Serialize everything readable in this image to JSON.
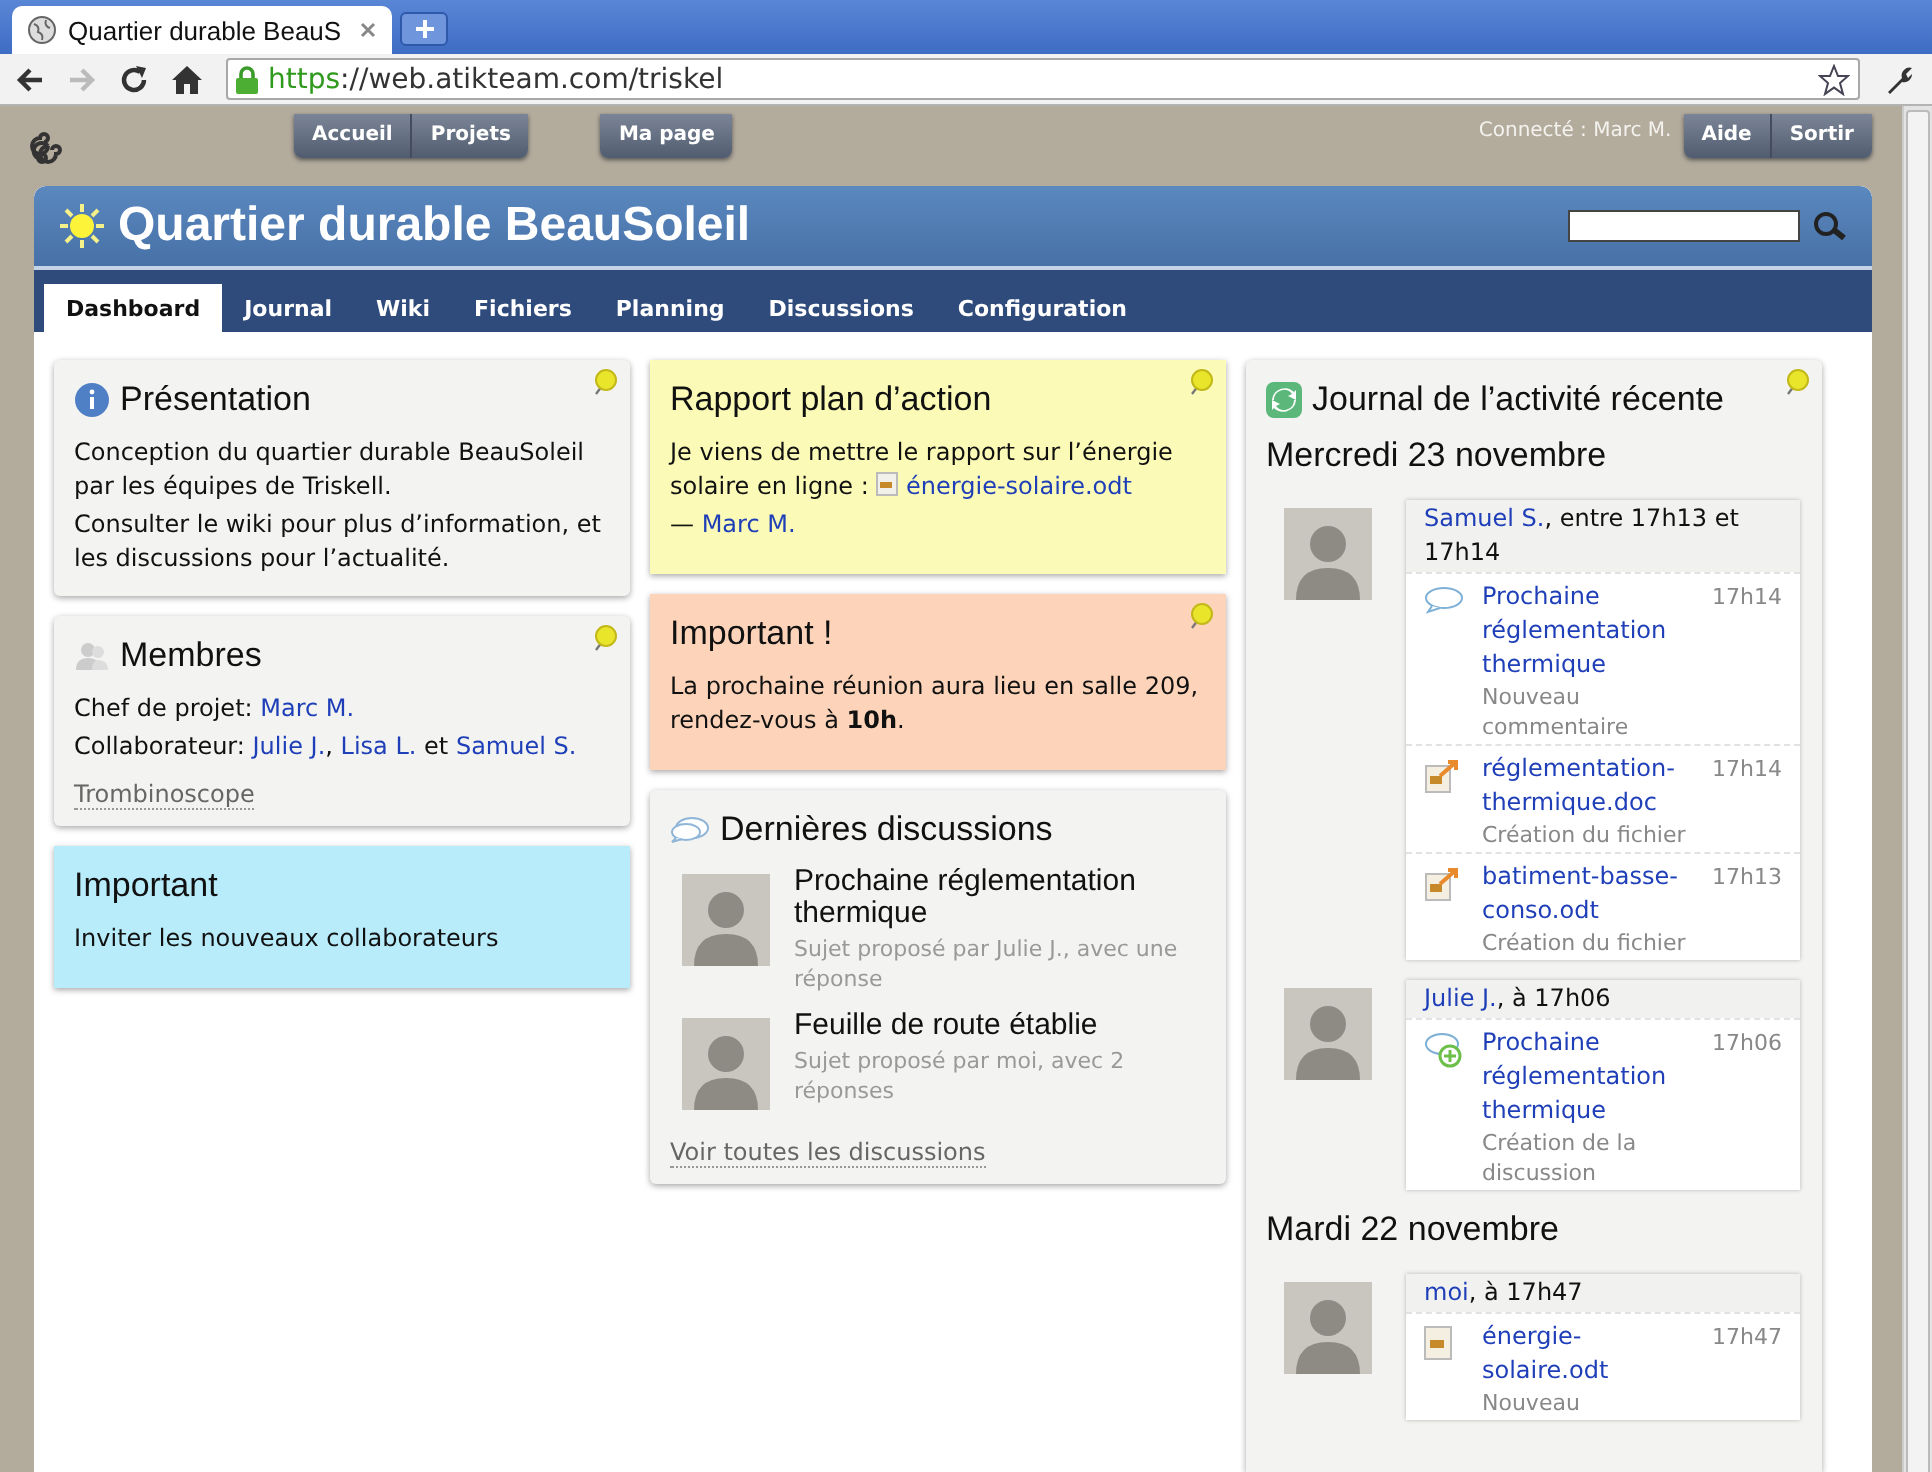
{
  "browser": {
    "tab_title": "Quartier durable BeauS",
    "url_scheme": "https",
    "url_rest": "://web.atikteam.com/triskel"
  },
  "top_nav": {
    "left_buttons": [
      "Accueil",
      "Projets"
    ],
    "my_page": "Ma page",
    "connected": "Connecté : Marc M.",
    "right_buttons": [
      "Aide",
      "Sortir"
    ]
  },
  "title": "Quartier durable BeauSoleil",
  "tabs": [
    {
      "label": "Dashboard",
      "selected": true
    },
    {
      "label": "Journal",
      "selected": false
    },
    {
      "label": "Wiki",
      "selected": false
    },
    {
      "label": "Fichiers",
      "selected": false
    },
    {
      "label": "Planning",
      "selected": false
    },
    {
      "label": "Discussions",
      "selected": false
    },
    {
      "label": "Configuration",
      "selected": false
    }
  ],
  "columns": [
    [
      {
        "kind": "presentation",
        "title": "Présentation",
        "color": "#f3f4f1",
        "pinned": true,
        "lines": [
          [
            {
              "kind": "text",
              "text": "Conception du quartier durable BeauSoleil par les équipes de Triskell."
            }
          ],
          [
            {
              "kind": "text",
              "text": "Consulter le wiki pour plus d’information, et les discussions pour l’actualité."
            }
          ]
        ]
      },
      {
        "kind": "members",
        "title": "Membres",
        "color": "#f3f4f1",
        "pinned": true,
        "lines": [
          [
            {
              "kind": "text",
              "text": "Chef de projet: "
            },
            {
              "kind": "link",
              "text": "Marc M."
            }
          ],
          [
            {
              "kind": "text",
              "text": "Collaborateur: "
            },
            {
              "kind": "link",
              "text": "Julie J."
            },
            {
              "kind": "text",
              "text": ", "
            },
            {
              "kind": "link",
              "text": "Lisa L."
            },
            {
              "kind": "text",
              "text": " et "
            },
            {
              "kind": "link",
              "text": "Samuel S."
            }
          ]
        ],
        "footer_link": "Trombinoscope"
      },
      {
        "kind": "note",
        "title": "Important",
        "color": "#b8ecfb",
        "pinned": false,
        "lines": [
          [
            {
              "kind": "text",
              "text": "Inviter les nouveaux collaborateurs"
            }
          ]
        ]
      }
    ],
    [
      {
        "kind": "note",
        "title": "Rapport plan d’action",
        "color": "#fbfbb7",
        "pinned": true,
        "lines": [
          [
            {
              "kind": "text",
              "text": "Je viens de mettre le rapport sur l’énergie solaire en ligne : "
            },
            {
              "kind": "file",
              "text": "énergie-solaire.odt"
            }
          ],
          [
            {
              "kind": "text",
              "text": "— "
            },
            {
              "kind": "link",
              "text": "Marc M."
            }
          ]
        ]
      },
      {
        "kind": "note",
        "title": "Important !",
        "color": "#fdd4b9",
        "pinned": true,
        "lines": [
          [
            {
              "kind": "text",
              "text": "La prochaine réunion aura lieu en salle 209, rendez-vous à "
            },
            {
              "kind": "bold",
              "text": "10h"
            },
            {
              "kind": "text",
              "text": "."
            }
          ]
        ]
      },
      {
        "kind": "discussions",
        "title": "Dernières discussions",
        "color": "#f3f4f1",
        "pinned": false,
        "items": [
          {
            "title": "Prochaine réglementation thermique",
            "subtitle": "Sujet proposé par Julie J., avec une réponse"
          },
          {
            "title": "Feuille de route établie",
            "subtitle": "Sujet proposé par moi, avec 2 réponses"
          }
        ],
        "footer_link": "Voir toutes les discussions"
      }
    ],
    [
      {
        "kind": "journal",
        "title": "Journal de l’activité récente",
        "color": "#f3f4f1",
        "pinned": true,
        "days": [
          {
            "date": "Mercredi 23 novembre",
            "groups": [
              {
                "user": "Samuel S.",
                "rest": ", entre 17h13 et 17h14",
                "entries": [
                  {
                    "kind": "comment",
                    "title": "Prochaine réglementation thermique",
                    "time": "17h14",
                    "subtitle": "Nouveau commentaire"
                  },
                  {
                    "kind": "file-upload",
                    "title": "réglementation-thermique.doc",
                    "time": "17h14",
                    "subtitle": "Création du fichier"
                  },
                  {
                    "kind": "file-upload",
                    "title": "batiment-basse-conso.odt",
                    "time": "17h13",
                    "subtitle": "Création du fichier"
                  }
                ]
              },
              {
                "user": "Julie J.",
                "rest": ", à 17h06",
                "entries": [
                  {
                    "kind": "discussion-new",
                    "title": "Prochaine réglementation thermique",
                    "time": "17h06",
                    "subtitle": "Création de la discussion"
                  }
                ]
              }
            ]
          },
          {
            "date": "Mardi 22 novembre",
            "groups": [
              {
                "user": "moi",
                "rest": ", à 17h47",
                "entries": [
                  {
                    "kind": "file",
                    "title": "énergie-solaire.odt",
                    "time": "17h47",
                    "subtitle": "Nouveau"
                  }
                ]
              }
            ]
          }
        ]
      }
    ]
  ]
}
